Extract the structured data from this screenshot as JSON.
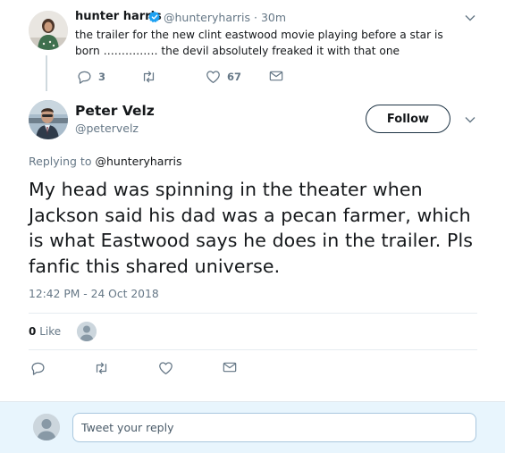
{
  "parent_tweet": {
    "name": "hunter harris",
    "handle": "@hunteryharris",
    "time": "· 30m",
    "text": "the trailer for the new clint eastwood movie playing before a star is born …………… the devil absolutely freaked it with that one",
    "reply_count": "3",
    "retweet_count": "",
    "like_count": "67",
    "verified": true
  },
  "main_tweet": {
    "name": "Peter Velz",
    "handle": "@petervelz",
    "follow_label": "Follow",
    "replying_prefix": "Replying to",
    "replying_to": "@hunteryharris",
    "text": "My head was spinning in the theater when Jackson said his dad was a pecan farmer, which is what Eastwood says he does in the trailer. Pls fanfic this shared universe.",
    "timestamp": "12:42 PM - 24 Oct 2018",
    "like_count": "0",
    "like_label": "Like"
  },
  "reply_box": {
    "placeholder": "Tweet your reply"
  },
  "colors": {
    "text": "#14171a",
    "secondary": "#657786",
    "verified_blue": "#1da1f2",
    "reply_bar_bg": "#e8f5fd"
  },
  "icons": [
    "verified-badge-icon",
    "chevron-down-icon",
    "reply-icon",
    "retweet-icon",
    "heart-icon",
    "envelope-icon"
  ]
}
